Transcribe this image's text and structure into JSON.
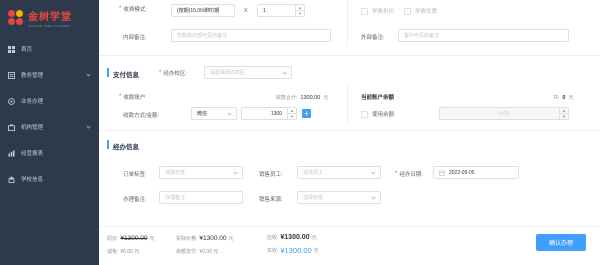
{
  "sidebar": {
    "logo_title": "金树学堂",
    "logo_sub": "GOLDEN TREE ACADEMY",
    "items": [
      {
        "label": "首页",
        "icon": "dashboard-icon",
        "chevron": false
      },
      {
        "label": "教务管理",
        "icon": "education-icon",
        "chevron": true
      },
      {
        "label": "业务办理",
        "icon": "business-icon",
        "chevron": false
      },
      {
        "label": "机构管理",
        "icon": "organization-icon",
        "chevron": true
      },
      {
        "label": "经营报表",
        "icon": "report-icon",
        "chevron": false
      },
      {
        "label": "学校信息",
        "icon": "school-icon",
        "chevron": false
      }
    ]
  },
  "fee": {
    "mode_label": "收费模式:",
    "mode_value": "(按期)15.00课时/期",
    "times": "X",
    "qty": "1",
    "discount_label": "学费折扣",
    "coupon_label": "学费优惠",
    "internal_note_label": "内部备注:",
    "internal_note_placeholder": "仅机构内部可见的备注",
    "external_note_label": "外部备注:",
    "external_note_placeholder": "客户可见的备注"
  },
  "payment": {
    "title": "支付信息",
    "campus_label": "经办校区:",
    "campus_placeholder": "请选择经办校区",
    "account_label": "收款账户",
    "total_label": "收款合计:",
    "total_value": "1300.00",
    "total_unit": "元",
    "method_label": "收款方式/金额:",
    "method_value": "微信",
    "amount_value": "1300",
    "balance_title": "当前账户余额",
    "balance_total_label": "共:",
    "balance_total_value": "0",
    "balance_total_unit": "元",
    "use_balance_label": "使用余额:",
    "use_balance_value": "0.00"
  },
  "handle": {
    "title": "经办信息",
    "order_tag_label": "订单标签:",
    "order_tag_placeholder": "选择标签",
    "sales_label": "销售员工:",
    "sales_placeholder": "选择员工",
    "date_label": "经办日期:",
    "date_value": "2022-05-05",
    "note_label": "办理备注:",
    "note_placeholder": "办理备注",
    "source_label": "销售来源:",
    "source_placeholder": "选择标签"
  },
  "footer": {
    "orig_label": "原价:",
    "orig_value": "¥1300.00",
    "orig_unit": "元",
    "actual_label": "实际价格:",
    "actual_value": "¥1300.00",
    "actual_unit": "元",
    "receivable_label": "应收:",
    "receivable_value": "¥1300.00",
    "receivable_unit": "元",
    "reduce_label": "减免:",
    "reduce_value": "¥0.00 元",
    "balance_pay_label": "余额支付:",
    "balance_pay_value": "¥0.00 元",
    "paid_label": "实收:",
    "paid_value": "¥1300.00",
    "paid_unit": "元",
    "confirm_label": "确认办理"
  },
  "colors": {
    "sidebar_bg": "#2d3a4b",
    "accent": "#409eff",
    "required": "#e8473c"
  }
}
